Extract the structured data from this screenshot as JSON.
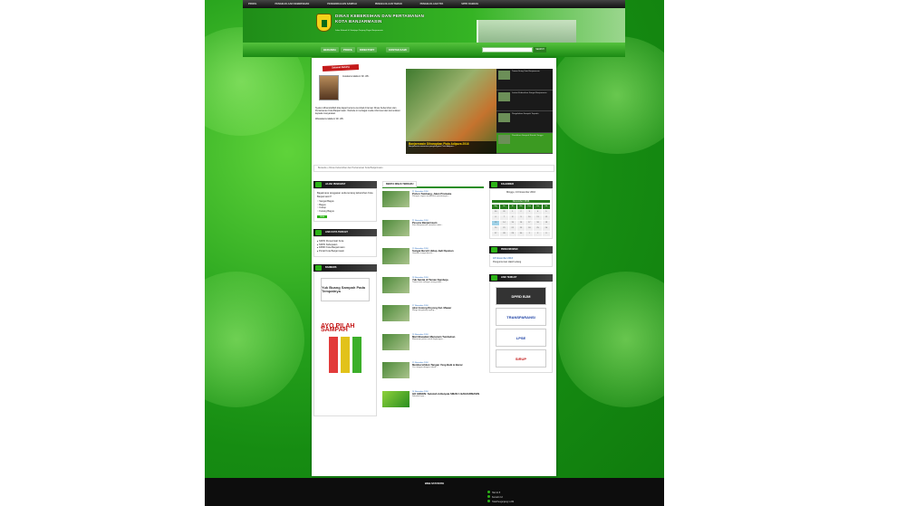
{
  "topnav": [
    "PROFIL",
    "PENGELOLAAN KEBERSIHAN",
    "PENGENDALIAN SAMPAH",
    "PENGELOLAAN TAMAN",
    "PENGELOLAAN TPA",
    "SPPD DAERAH"
  ],
  "header": {
    "title_line1": "DINAS KEBERSIHAN DAN PERTAMANAN",
    "title_line2": "KOTA BANJARMASIN",
    "subtitle": "Jalan Kolonel H. Sriwijaya Tanjung Pagar Banjarmasin"
  },
  "mainnav": [
    "BERANDA",
    "PROFIL",
    "DIRECTORY",
    "KONTAK KAMI"
  ],
  "search": {
    "placeholder": "",
    "button": "SEARCH"
  },
  "welcome": {
    "ribbon": "Selamat Datang",
    "greeting": "Assalamu'alaikum Wr. Wb.",
    "body": "Syukur Alhamdulillah kita dapat bertemu kembali di laman Dinas Kebersihan dan Pertamanan Kota Banjarmasin. Website ini sebagai media informasi dan komunikasi kepada masyarakat.",
    "closing": "Wassalamu'alaikum Wr. Wb."
  },
  "slider": {
    "title": "Banjarmasin Diharapkan Piala Adipura 2016",
    "desc": "Banjarmasin menerima penghargaan Piala Adipura..."
  },
  "thumbs": [
    "Taman Siring Kota Banjarmasin",
    "Lestari Kebersihan Sungai Banjarmasin",
    "Pengelolaan Sampah Terpadu",
    "Pemilahan Sampah Rumah Tangga"
  ],
  "breadcrumb": "Beranda  »  Dinas Kebersihan dan Pertamanan Kota Banjarmasin",
  "poll": {
    "head": "JAJAK PENDAPAT",
    "question": "Bagaimana tanggapan anda tentang kebersihan Kota Banjarmasin?",
    "options": [
      "Sangat Bagus",
      "Bagus",
      "Cukup",
      "Kurang Bagus"
    ],
    "button": "Vote"
  },
  "links": {
    "head": "LINK KOTA TERKAIT",
    "items": [
      "SKPD Pemerintah Kota",
      "SKPD Kabupaten",
      "DPRD Kota Banjarmasin",
      "Portal Kota Banjarmasin"
    ]
  },
  "banners_head": "BANNERS",
  "banner_left": [
    "Yuk Buang Sampah Pada Tempatnya",
    "AYO PILAH SAMPAH"
  ],
  "news_head": "BERITA DINAS TERBARU",
  "news": [
    {
      "meta": "21 November 2016",
      "title": "Pohon Tumbang, Jalan Pramuka",
      "ex": "Petugas segera melakukan pemotongan..."
    },
    {
      "meta": "21 November 2016",
      "title": "Pesona Banjarmasin",
      "ex": "Kota Banjarmasin semakin indah..."
    },
    {
      "meta": "19 November 2016",
      "title": "Sungai Bersih Hidup Jadi Nyaman",
      "ex": "Gerakan sungai bersih..."
    },
    {
      "meta": "18 November 2016",
      "title": "Yuk Santai di Taman Kamboja",
      "ex": "Taman kota sebagai ruang publik..."
    },
    {
      "meta": "17 November 2016",
      "title": "Aksi Gotong Royong Kel. Mawar",
      "ex": "Warga bergotong royong..."
    },
    {
      "meta": "16 November 2016",
      "title": "Mari Biasakan Menanam Tumbuhan",
      "ex": "Menanam pohon untuk lingkungan..."
    },
    {
      "meta": "15 November 2016",
      "title": "Membersihkan Tangan Yang Baik & Benar",
      "ex": "Cuci tangan dengan sabun..."
    },
    {
      "meta": "14 November 2016",
      "title": "GO GREEN: Sekolah Adiwiyata SMAN 1 BANJARMASIN",
      "ex": "Sekolah hijau..."
    }
  ],
  "calendar": {
    "head": "KALENDER",
    "date": "Minggu, 13 November 2016",
    "month": "November 2016",
    "weekdays": [
      "Mg",
      "Sn",
      "Sl",
      "Rb",
      "Km",
      "Jm",
      "Sb"
    ],
    "days": [
      "30",
      "31",
      "1",
      "2",
      "3",
      "4",
      "5",
      "6",
      "7",
      "8",
      "9",
      "10",
      "11",
      "12",
      "13",
      "14",
      "15",
      "16",
      "17",
      "18",
      "19",
      "20",
      "21",
      "22",
      "23",
      "24",
      "25",
      "26",
      "27",
      "28",
      "29",
      "30",
      "1",
      "2",
      "3"
    ]
  },
  "announce": {
    "head": "PENGUMUMAN",
    "date": "18 November 2016",
    "text": "Pengumuman Hasil Lelang"
  },
  "rlinks_head": "LINK TERKAIT",
  "rlinks": [
    "DPRD BJM",
    "TRANSPARANSI",
    "LPSE",
    "SiRUP"
  ],
  "footer": {
    "head": "WEB STATISTIK",
    "stats": [
      {
        "label": "Hari Ini",
        "value": "5"
      },
      {
        "label": "Kemarin",
        "value": "12"
      },
      {
        "label": "Total Pengunjung",
        "value": "1.234"
      }
    ]
  }
}
